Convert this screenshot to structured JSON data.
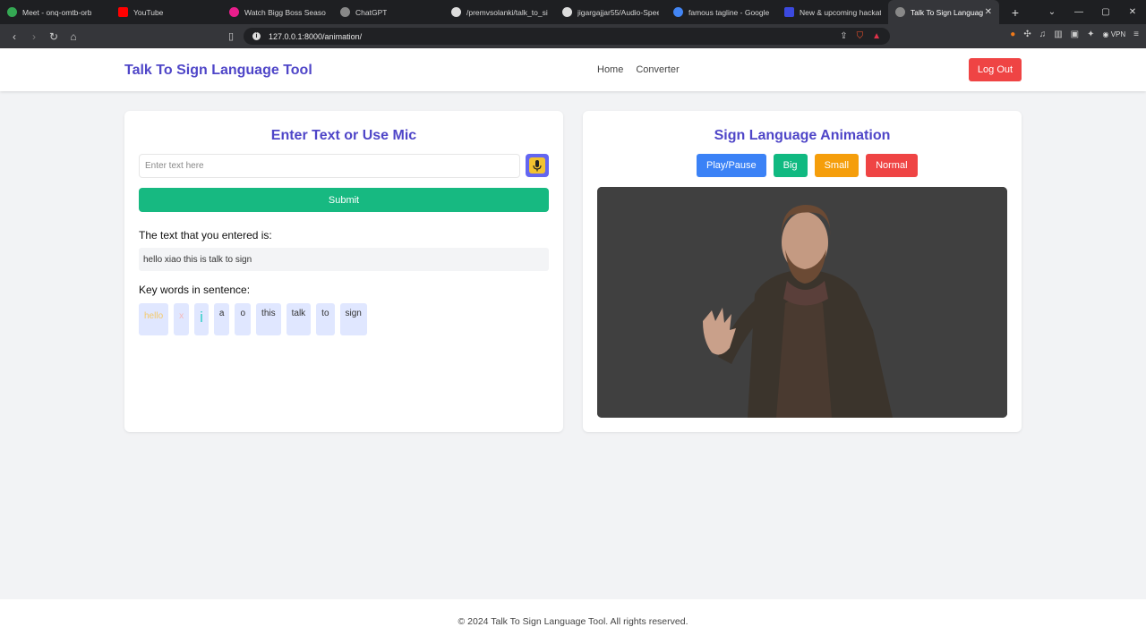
{
  "browser": {
    "tabs": [
      {
        "title": "Meet - onq-omtb-orb",
        "color": "#34a853"
      },
      {
        "title": "YouTube",
        "color": "#ff0000"
      },
      {
        "title": "Watch Bigg Boss Season",
        "color": "#e91e8c"
      },
      {
        "title": "ChatGPT",
        "color": "#888888"
      },
      {
        "title": "/premvsolanki/talk_to_sig",
        "color": "#dddddd"
      },
      {
        "title": "jigargajjar55/Audio-Spee",
        "color": "#dddddd"
      },
      {
        "title": "famous tagline - Google S",
        "color": "#4285f4"
      },
      {
        "title": "New & upcoming hackath",
        "color": "#3b49df"
      },
      {
        "title": "Talk To Sign Languag",
        "color": "#888888"
      }
    ],
    "new_tab": "+",
    "url": "127.0.0.1:8000/animation/",
    "vpn_label": "VPN"
  },
  "header": {
    "brand": "Talk To Sign Language Tool",
    "nav": [
      "Home",
      "Converter"
    ],
    "logout": "Log Out"
  },
  "input_card": {
    "title": "Enter Text or Use Mic",
    "placeholder": "Enter text here",
    "submit": "Submit",
    "entered_label": "The text that you entered is:",
    "entered_value": "hello xiao this is talk to sign",
    "keywords_label": "Key words in sentence:",
    "keywords": [
      {
        "text": "hello",
        "color": "#f5c96a"
      },
      {
        "text": "x",
        "color": "#f5b8b8"
      },
      {
        "text": "i",
        "color": "#34d0c8"
      },
      {
        "text": "a",
        "color": "#333333"
      },
      {
        "text": "o",
        "color": "#333333"
      },
      {
        "text": "this",
        "color": "#333333"
      },
      {
        "text": "talk",
        "color": "#333333"
      },
      {
        "text": "to",
        "color": "#333333"
      },
      {
        "text": "sign",
        "color": "#333333"
      }
    ]
  },
  "animation_card": {
    "title": "Sign Language Animation",
    "controls": [
      {
        "label": "Play/Pause",
        "color": "#3b82f6"
      },
      {
        "label": "Big",
        "color": "#10b981"
      },
      {
        "label": "Small",
        "color": "#f59e0b"
      },
      {
        "label": "Normal",
        "color": "#ef4444"
      }
    ]
  },
  "footer": "© 2024 Talk To Sign Language Tool. All rights reserved."
}
